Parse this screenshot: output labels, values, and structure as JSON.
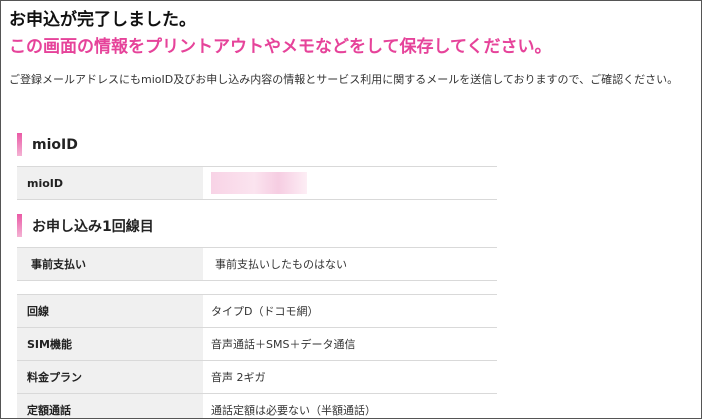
{
  "header": {
    "title": "お申込が完了しました。",
    "subtitle": "この画面の情報をプリントアウトやメモなどをして保存してください。",
    "notice": "ご登録メールアドレスにもmioID及びお申し込み内容の情報とサービス利用に関するメールを送信しておりますので、ご確認ください。"
  },
  "mioid_section": {
    "heading": "mioID",
    "rows": [
      {
        "label": "mioID",
        "value": ""
      }
    ]
  },
  "line_section": {
    "heading": "お申し込み1回線目",
    "prepay_rows": [
      {
        "label": "事前支払い",
        "value": "事前支払いしたものはない"
      }
    ],
    "detail_rows": [
      {
        "label": "回線",
        "value": "タイプD（ドコモ網）"
      },
      {
        "label": "SIM機能",
        "value": "音声通話＋SMS＋データ通信"
      },
      {
        "label": "料金プラン",
        "value": "音声 2ギガ"
      },
      {
        "label": "定額通話",
        "value": "通話定額は必要ない（半額通話）"
      }
    ]
  },
  "colors": {
    "accent_pink": "#e6439a",
    "row_label_bg": "#f0f0f0",
    "divider": "#d9d9d9"
  }
}
